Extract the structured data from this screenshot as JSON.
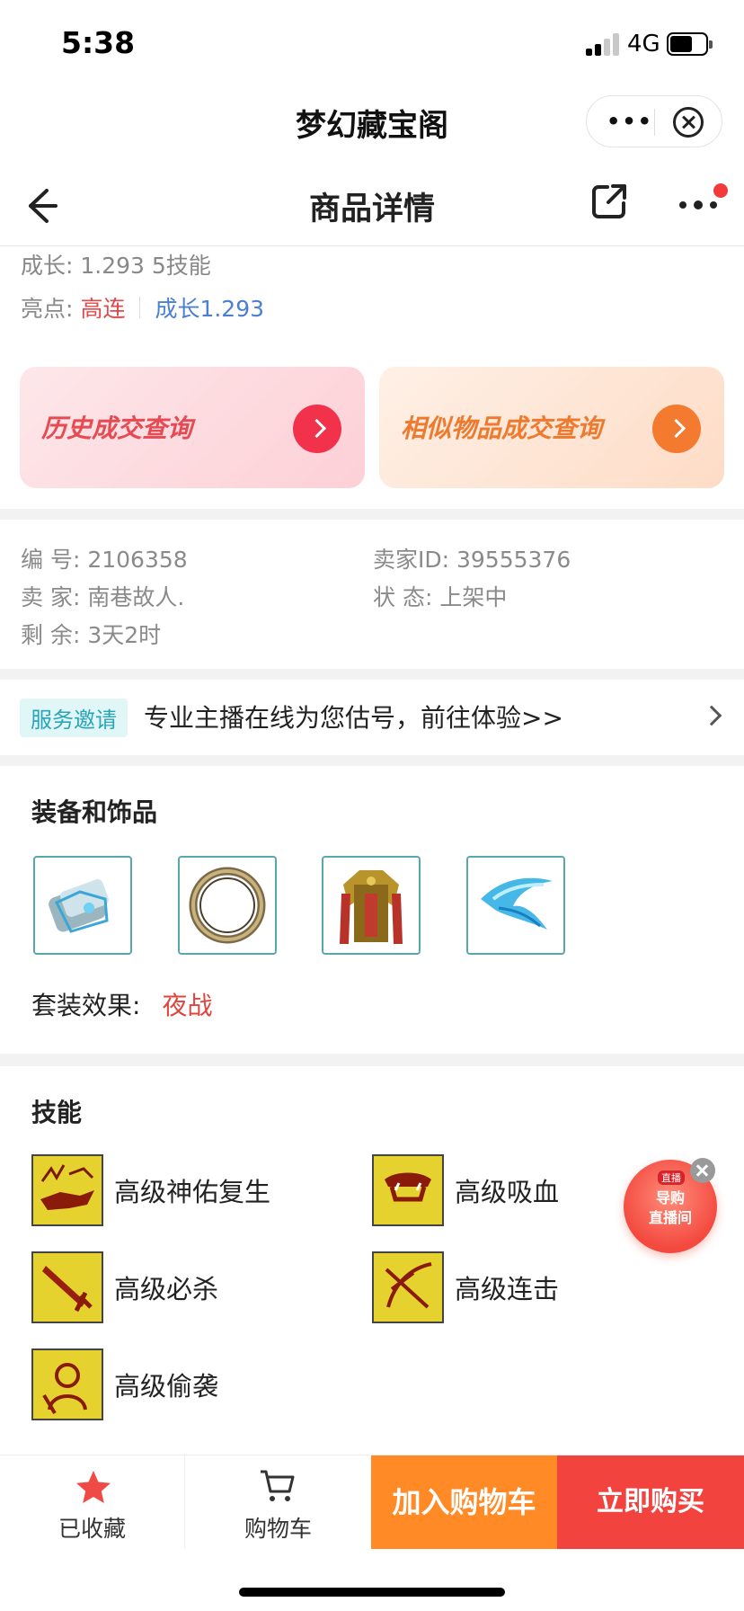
{
  "status_bar": {
    "time": "5:38",
    "network": "4G"
  },
  "mini_program": {
    "title": "梦幻藏宝阁"
  },
  "header": {
    "title": "商品详情"
  },
  "summary": {
    "growth_line": "成长: 1.293 5技能",
    "highlights_label": "亮点:",
    "highlight_tags": [
      "高连",
      "成长1.293"
    ]
  },
  "query_cards": [
    {
      "label": "历史成交查询"
    },
    {
      "label": "相似物品成交查询"
    }
  ],
  "info": {
    "id": "编  号: 2106358",
    "seller_id": "卖家ID: 39555376",
    "seller": "卖  家: 南巷故人.",
    "status": "状  态: 上架中",
    "remaining": "剩  余: 3天2时"
  },
  "service": {
    "tag": "服务邀请",
    "text": "专业主播在线为您估号，前往体验>>"
  },
  "equipment": {
    "title": "装备和饰品",
    "items": [
      {
        "icon": "equipment-armguard-icon"
      },
      {
        "icon": "equipment-ring-icon"
      },
      {
        "icon": "equipment-armor-icon"
      },
      {
        "icon": "equipment-claw-icon"
      }
    ],
    "set_label": "套装效果:",
    "set_value": "夜战"
  },
  "skills": {
    "title": "技能",
    "items": [
      {
        "name": "高级神佑复生",
        "icon": "skill-revive-icon"
      },
      {
        "name": "高级吸血",
        "icon": "skill-bloodsuck-icon"
      },
      {
        "name": "高级必杀",
        "icon": "skill-critical-icon"
      },
      {
        "name": "高级连击",
        "icon": "skill-combo-icon"
      },
      {
        "name": "高级偷袭",
        "icon": "skill-sneak-icon"
      }
    ]
  },
  "live_float": {
    "tag": "直播",
    "line1": "导购",
    "line2": "直播间"
  },
  "bottom_bar": {
    "favorite_label": "已收藏",
    "cart_label": "购物车",
    "add_to_cart": "加入购物车",
    "buy_now": "立即购买"
  },
  "colors": {
    "accent_red": "#f2433f",
    "accent_orange": "#ff8a26",
    "highlight_red": "#e0494a",
    "highlight_blue": "#4a7fd3",
    "service_teal": "#2aa4b8"
  }
}
